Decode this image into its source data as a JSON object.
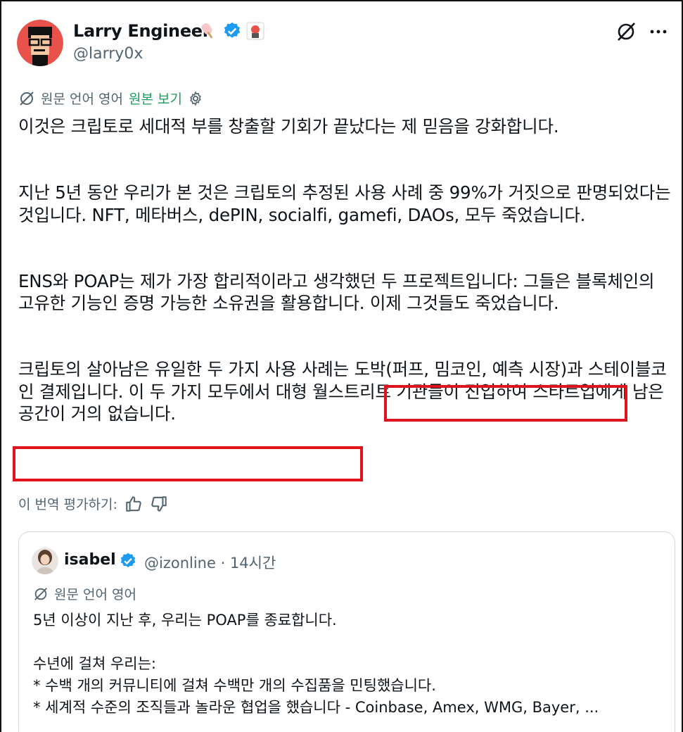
{
  "author": {
    "name": "Larry Engineer",
    "handle": "@larry0x"
  },
  "translation_bar": {
    "language_label": "원문 언어 영어",
    "show_original": "원본 보기"
  },
  "post": {
    "paragraphs": [
      "이것은 크립토로 세대적 부를 창출할 기회가 끝났다는 제 믿음을 강화합니다.",
      "지난 5년 동안 우리가 본 것은 크립토의 추정된 사용 사례 중 99%가 거짓으로 판명되었다는 것입니다. NFT, 메타버스, dePIN, socialfi, gamefi, DAOs, 모두 죽었습니다.",
      "ENS와 POAP는 제가 가장 합리적이라고 생각했던 두 프로젝트입니다: 그들은 블록체인의 고유한 기능인 증명 가능한 소유권을 활용합니다. 이제 그것들도 죽었습니다.",
      "크립토의 살아남은 유일한 두 가지 사용 사례는 도박(퍼프, 밈코인, 예측 시장)과 스테이블코인 결제입니다. 이 두 가지 모두에서 대형 월스트리트 기관들이 진입하여 스타트업에게 남은 공간이 거의 없습니다."
    ]
  },
  "rate_translation": "이 번역 평가하기:",
  "quoted": {
    "name": "isabel",
    "handle_time": "@izonline · 14시간",
    "language_label": "원문 언어 영어",
    "text": "5년 이상이 지난 후, 우리는 POAP를 종료합니다.\n\n수년에 걸쳐 우리는:\n* 수백 개의 커뮤니티에 걸쳐 수백만 개의 수집품을 민팅했습니다.\n* 세계적 수준의 조직들과 놀라운 협업을 했습니다 - Coinbase, Amex, WMG, Bayer, ..."
  },
  "colors": {
    "verified": "#1d9bf0",
    "highlight": "#e0121c",
    "link_green": "#1d9b5a"
  }
}
